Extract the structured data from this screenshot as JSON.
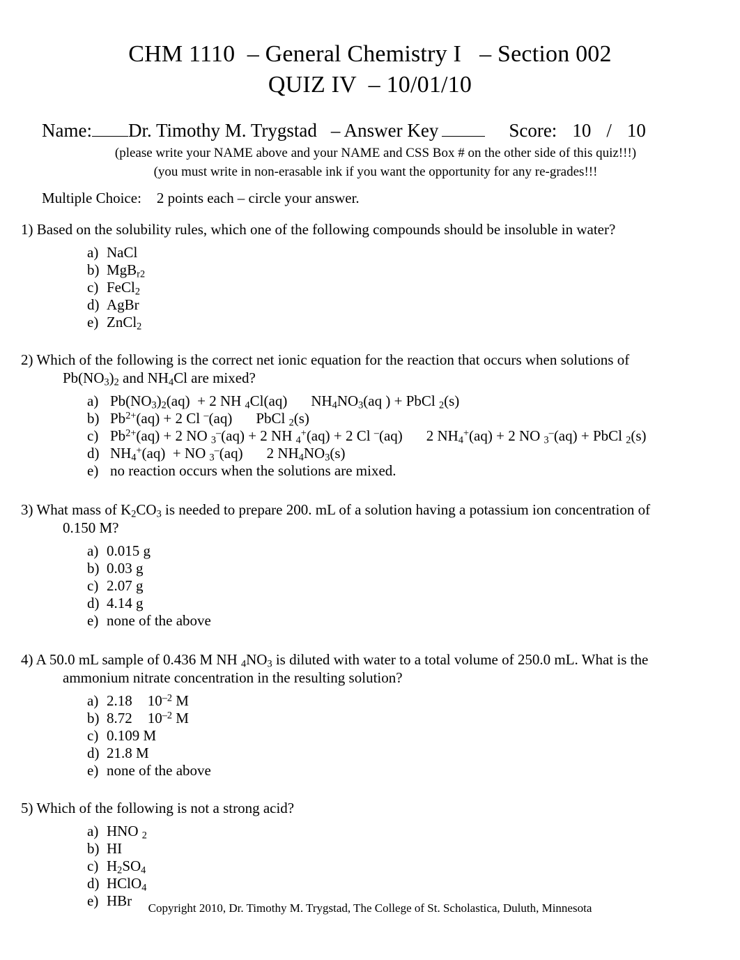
{
  "header": {
    "title_line1": "CHM 1110  – General Chemistry I   – Section 002",
    "title_line2": "QUIZ IV  – 10/01/10",
    "name_label": "Name:",
    "name_value": "Dr. Timothy M. Trygstad",
    "answer_key_label": "– Answer Key",
    "score_label": "Score:",
    "score_value": "10",
    "score_separator": "/",
    "score_total": "10",
    "instruction_line1": "(please write your NAME above and your NAME and CSS Box # on the other side of this quiz!!!)",
    "instruction_line2": "(you must write in non-erasable ink if you want the opportunity for any re-grades!!!",
    "section_label": "Multiple Choice:",
    "section_points": "2 points each",
    "section_directions": "– circle your answer."
  },
  "questions": [
    {
      "number": "1)",
      "text": "Based on the solubility rules, which one of the following compounds should be insoluble in water?",
      "text_cont": "",
      "options": [
        {
          "label": "a)",
          "parts": [
            {
              "t": "NaCl"
            }
          ]
        },
        {
          "label": "b)",
          "parts": [
            {
              "t": "MgB"
            },
            {
              "t": "r2",
              "k": "sub"
            }
          ]
        },
        {
          "label": "c)",
          "parts": [
            {
              "t": "FeCl"
            },
            {
              "t": "2",
              "k": "sub"
            }
          ]
        },
        {
          "label": "d)",
          "parts": [
            {
              "t": "AgBr"
            }
          ]
        },
        {
          "label": "e)",
          "parts": [
            {
              "t": "ZnCl"
            },
            {
              "t": "2",
              "k": "sub"
            }
          ]
        }
      ]
    },
    {
      "number": "2)",
      "text": "Which of the following is the correct net ionic equation for the reaction that occurs when solutions of",
      "text_cont_parts": [
        {
          "t": "Pb(NO"
        },
        {
          "t": "3",
          "k": "sub"
        },
        {
          "t": ")"
        },
        {
          "t": "2",
          "k": "sub"
        },
        {
          "t": " and NH"
        },
        {
          "t": "4",
          "k": "sub"
        },
        {
          "t": "Cl are mixed?"
        }
      ],
      "options": [
        {
          "label": "a)",
          "wide": true,
          "parts": [
            {
              "t": "Pb(NO"
            },
            {
              "t": "3",
              "k": "sub"
            },
            {
              "t": ")"
            },
            {
              "t": "2",
              "k": "sub"
            },
            {
              "t": "(aq)  + 2 NH "
            },
            {
              "t": "4",
              "k": "sub"
            },
            {
              "t": "Cl(aq)"
            },
            {
              "k": "gap"
            },
            {
              "t": "NH"
            },
            {
              "t": "4",
              "k": "sub"
            },
            {
              "t": "NO"
            },
            {
              "t": "3",
              "k": "sub"
            },
            {
              "t": "(aq ) + PbCl "
            },
            {
              "t": "2",
              "k": "sub"
            },
            {
              "t": "(s)"
            }
          ]
        },
        {
          "label": "b)",
          "wide": true,
          "parts": [
            {
              "t": "Pb"
            },
            {
              "t": "2+",
              "k": "sup"
            },
            {
              "t": "(aq) + 2 Cl "
            },
            {
              "t": "–",
              "k": "sup"
            },
            {
              "t": "(aq)"
            },
            {
              "k": "gap"
            },
            {
              "t": "PbCl "
            },
            {
              "t": "2",
              "k": "sub"
            },
            {
              "t": "(s)"
            }
          ]
        },
        {
          "label": "c)",
          "wide": true,
          "parts": [
            {
              "t": "Pb"
            },
            {
              "t": "2+",
              "k": "sup"
            },
            {
              "t": "(aq) + 2 NO "
            },
            {
              "t": "3",
              "k": "sub"
            },
            {
              "t": "–",
              "k": "sup"
            },
            {
              "t": "(aq) + 2 NH "
            },
            {
              "t": "4",
              "k": "sub"
            },
            {
              "t": "+",
              "k": "sup"
            },
            {
              "t": "(aq) + 2 Cl "
            },
            {
              "t": "–",
              "k": "sup"
            },
            {
              "t": "(aq)"
            },
            {
              "k": "gap"
            },
            {
              "t": "2 NH"
            },
            {
              "t": "4",
              "k": "sub"
            },
            {
              "t": "+",
              "k": "sup"
            },
            {
              "t": "(aq) + 2 NO "
            },
            {
              "t": "3",
              "k": "sub"
            },
            {
              "t": "–",
              "k": "sup"
            },
            {
              "t": "(aq) + PbCl "
            },
            {
              "t": "2",
              "k": "sub"
            },
            {
              "t": "(s)"
            }
          ]
        },
        {
          "label": "d)",
          "wide": true,
          "parts": [
            {
              "t": "NH"
            },
            {
              "t": "4",
              "k": "sub"
            },
            {
              "t": "+",
              "k": "sup"
            },
            {
              "t": "(aq)  + NO "
            },
            {
              "t": "3",
              "k": "sub"
            },
            {
              "t": "–",
              "k": "sup"
            },
            {
              "t": "(aq)"
            },
            {
              "k": "gap"
            },
            {
              "t": "2 NH"
            },
            {
              "t": "4",
              "k": "sub"
            },
            {
              "t": "NO"
            },
            {
              "t": "3",
              "k": "sub"
            },
            {
              "t": "(s)"
            }
          ]
        },
        {
          "label": "e)",
          "wide": true,
          "parts": [
            {
              "t": "no reaction occurs when the solutions are mixed."
            }
          ]
        }
      ]
    },
    {
      "number": "3)",
      "text_parts": [
        {
          "t": "What mass of K"
        },
        {
          "t": "2",
          "k": "sub"
        },
        {
          "t": "CO"
        },
        {
          "t": "3",
          "k": "sub"
        },
        {
          "t": " is needed to prepare 200. mL of a solution having a potassium ion concentration of"
        }
      ],
      "text_cont": "0.150 M?",
      "options": [
        {
          "label": "a)",
          "parts": [
            {
              "t": "0.015 g"
            }
          ]
        },
        {
          "label": "b)",
          "parts": [
            {
              "t": "0.03 g"
            }
          ]
        },
        {
          "label": "c)",
          "parts": [
            {
              "t": "2.07 g"
            }
          ]
        },
        {
          "label": "d)",
          "parts": [
            {
              "t": "4.14 g"
            }
          ]
        },
        {
          "label": "e)",
          "parts": [
            {
              "t": "none of the above"
            }
          ]
        }
      ]
    },
    {
      "number": "4)",
      "text_parts": [
        {
          "t": "A 50.0 mL sample of 0.436 M NH "
        },
        {
          "t": "4",
          "k": "sub"
        },
        {
          "t": "NO"
        },
        {
          "t": "3",
          "k": "sub"
        },
        {
          "t": " is diluted with water to a total volume of 250.0 mL.  What is the"
        }
      ],
      "text_cont": "ammonium nitrate concentration in the resulting solution?",
      "options": [
        {
          "label": "a)",
          "parts": [
            {
              "t": "2.18"
            },
            {
              "k": "gap-sm"
            },
            {
              "t": "10"
            },
            {
              "t": "–2",
              "k": "sup"
            },
            {
              "t": " M"
            }
          ]
        },
        {
          "label": "b)",
          "parts": [
            {
              "t": "8.72"
            },
            {
              "k": "gap-sm"
            },
            {
              "t": "10"
            },
            {
              "t": "–2",
              "k": "sup"
            },
            {
              "t": " M"
            }
          ]
        },
        {
          "label": "c)",
          "parts": [
            {
              "t": "0.109 M"
            }
          ]
        },
        {
          "label": "d)",
          "parts": [
            {
              "t": "21.8 M"
            }
          ]
        },
        {
          "label": "e)",
          "parts": [
            {
              "t": "none of the above"
            }
          ]
        }
      ]
    },
    {
      "number": "5)",
      "text": "Which of the following is not a strong acid?",
      "text_cont": "",
      "options": [
        {
          "label": "a)",
          "parts": [
            {
              "t": "HNO "
            },
            {
              "t": "2",
              "k": "sub"
            }
          ]
        },
        {
          "label": "b)",
          "parts": [
            {
              "t": "HI"
            }
          ]
        },
        {
          "label": "c)",
          "parts": [
            {
              "t": "H"
            },
            {
              "t": "2",
              "k": "sub"
            },
            {
              "t": "SO"
            },
            {
              "t": "4",
              "k": "sub"
            }
          ]
        },
        {
          "label": "d)",
          "parts": [
            {
              "t": "HClO"
            },
            {
              "t": "4",
              "k": "sub"
            }
          ]
        },
        {
          "label": "e)",
          "parts": [
            {
              "t": "HBr"
            }
          ]
        }
      ]
    }
  ],
  "footer": {
    "copyright": "Copyright 2010, Dr. Timothy M. Trygstad, The College of St. Scholastica, Duluth, Minnesota"
  }
}
